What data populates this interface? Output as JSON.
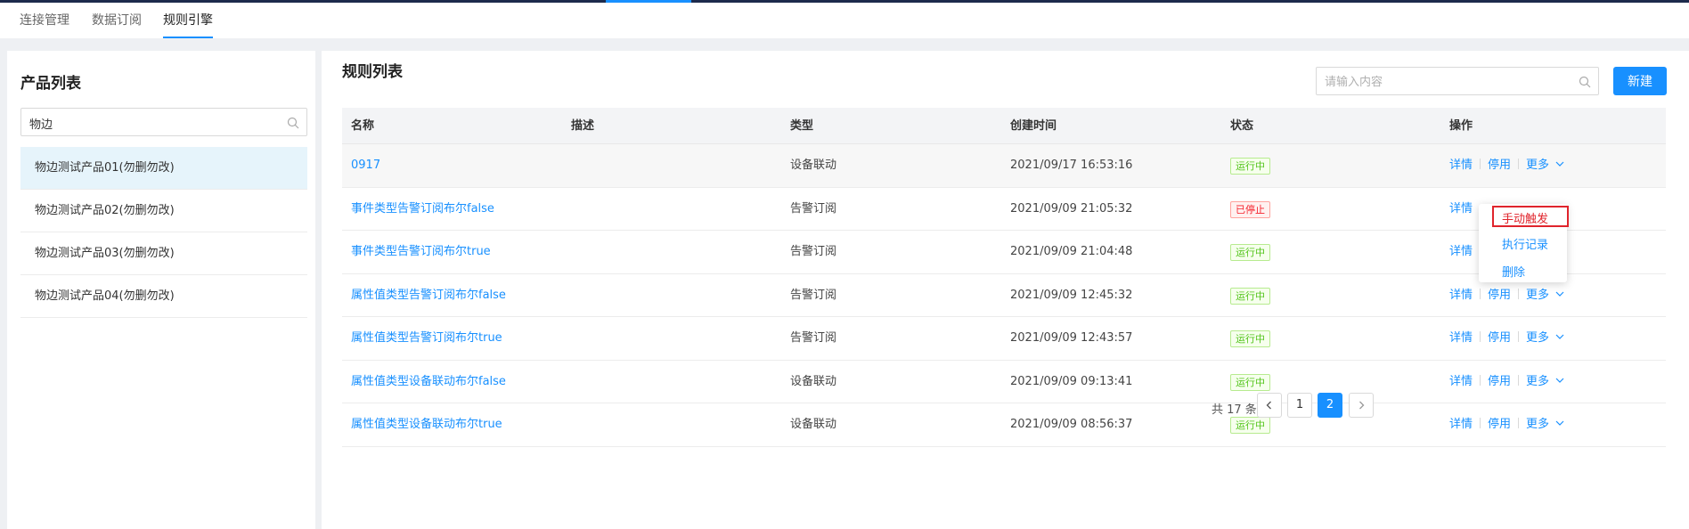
{
  "nav": {
    "tabs": [
      {
        "label": "连接管理"
      },
      {
        "label": "数据订阅"
      },
      {
        "label": "规则引擎"
      }
    ]
  },
  "left_panel": {
    "title": "产品列表",
    "search_value": "物边",
    "products": [
      "物边测试产品01(勿删勿改)",
      "物边测试产品02(勿删勿改)",
      "物边测试产品03(勿删勿改)",
      "物边测试产品04(勿删勿改)"
    ]
  },
  "right_panel": {
    "title": "规则列表",
    "search_placeholder": "请输入内容",
    "new_button": "新建",
    "columns": [
      "名称",
      "描述",
      "类型",
      "创建时间",
      "状态",
      "操作"
    ],
    "rows": [
      {
        "name": "0917",
        "description": "",
        "type": "设备联动",
        "created": "2021/09/17 16:53:16",
        "status": "运行中"
      },
      {
        "name": "事件类型告警订阅布尔false",
        "description": "",
        "type": "告警订阅",
        "created": "2021/09/09 21:05:32",
        "status": "已停止"
      },
      {
        "name": "事件类型告警订阅布尔true",
        "description": "",
        "type": "告警订阅",
        "created": "2021/09/09 21:04:48",
        "status": "运行中"
      },
      {
        "name": "属性值类型告警订阅布尔false",
        "description": "",
        "type": "告警订阅",
        "created": "2021/09/09 12:45:32",
        "status": "运行中"
      },
      {
        "name": "属性值类型告警订阅布尔true",
        "description": "",
        "type": "告警订阅",
        "created": "2021/09/09 12:43:57",
        "status": "运行中"
      },
      {
        "name": "属性值类型设备联动布尔false",
        "description": "",
        "type": "设备联动",
        "created": "2021/09/09 09:13:41",
        "status": "运行中"
      },
      {
        "name": "属性值类型设备联动布尔true",
        "description": "",
        "type": "设备联动",
        "created": "2021/09/09 08:56:37",
        "status": "运行中"
      }
    ],
    "ops": {
      "detail": "详情",
      "disable": "停用",
      "more": "更多"
    },
    "more_menu": [
      "手动触发",
      "执行记录",
      "删除"
    ],
    "pagination": {
      "total_text": "共 17 条",
      "pages": [
        "1",
        "2"
      ],
      "current": "2"
    }
  },
  "colors": {
    "accent": "#1890ff",
    "running": "#52c41a",
    "stopped": "#f5222d",
    "highlight_border": "#e0242c"
  }
}
